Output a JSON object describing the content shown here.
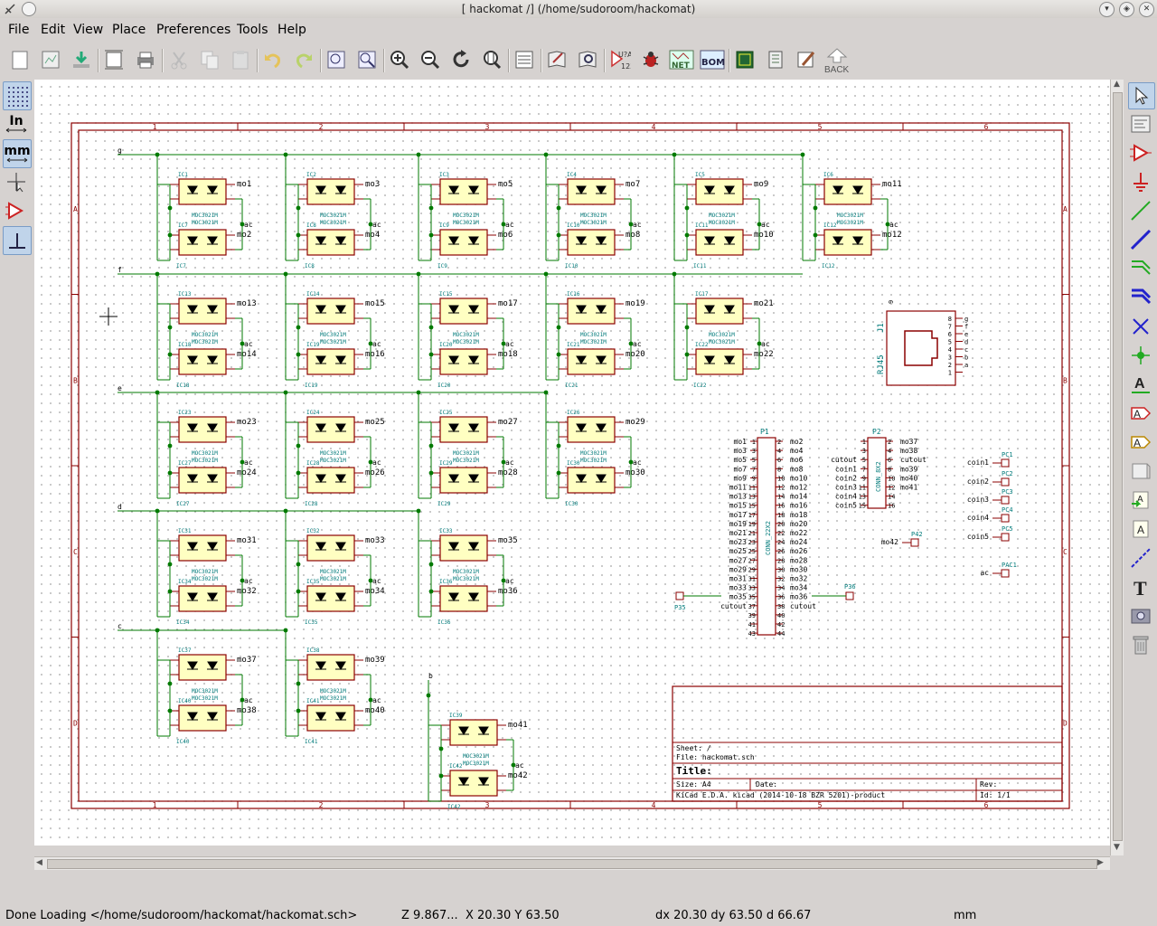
{
  "window": {
    "title": "[ hackomat /] (/home/sudoroom/hackomat)"
  },
  "menu": [
    "File",
    "Edit",
    "View",
    "Place",
    "Preferences",
    "Tools",
    "Help"
  ],
  "toolbar": {
    "back_label": "BACK",
    "net_label": "NET",
    "bom_label": "BOM",
    "annotate_label": "U?A 123"
  },
  "left_toolbar": {
    "inch_label": "In",
    "mm_label": "mm"
  },
  "status": {
    "message": "Done Loading </home/sudoroom/hackomat/hackomat.sch>",
    "zoom": "Z 9.867...",
    "xy": "X 20.30  Y 63.50",
    "delta": "dx 20.30  dy 63.50  d 66.67",
    "units": "mm"
  },
  "schematic": {
    "border_cols": [
      "1",
      "2",
      "3",
      "4",
      "5",
      "6"
    ],
    "border_rows": [
      "A",
      "B",
      "C",
      "D"
    ],
    "bus_labels": [
      "g",
      "f",
      "e",
      "d",
      "c",
      "b"
    ],
    "part_value": "MOC3021M",
    "pin_labels": [
      "a",
      "b",
      "c",
      "d",
      "e",
      "f",
      "g",
      "ac"
    ],
    "rows": [
      {
        "pairs": [
          {
            "ic_top": "IC1",
            "ic_bot": "IC7",
            "out_top": "mo1",
            "out_bot": "mo2"
          },
          {
            "ic_top": "IC2",
            "ic_bot": "IC8",
            "out_top": "mo3",
            "out_bot": "mo4"
          },
          {
            "ic_top": "IC3",
            "ic_bot": "IC9",
            "out_top": "mo5",
            "out_bot": "mo6"
          },
          {
            "ic_top": "IC4",
            "ic_bot": "IC10",
            "out_top": "mo7",
            "out_bot": "mo8"
          },
          {
            "ic_top": "IC5",
            "ic_bot": "IC11",
            "out_top": "mo9",
            "out_bot": "mo10"
          },
          {
            "ic_top": "IC6",
            "ic_bot": "IC12",
            "out_top": "mo11",
            "out_bot": "mo12"
          }
        ]
      },
      {
        "pairs": [
          {
            "ic_top": "IC13",
            "ic_bot": "IC18",
            "out_top": "mo13",
            "out_bot": "mo14"
          },
          {
            "ic_top": "IC14",
            "ic_bot": "IC19",
            "out_top": "mo15",
            "out_bot": "mo16"
          },
          {
            "ic_top": "IC15",
            "ic_bot": "IC20",
            "out_top": "mo17",
            "out_bot": "mo18"
          },
          {
            "ic_top": "IC16",
            "ic_bot": "IC21",
            "out_top": "mo19",
            "out_bot": "mo20"
          },
          {
            "ic_top": "IC17",
            "ic_bot": "IC22",
            "out_top": "mo21",
            "out_bot": "mo22"
          }
        ]
      },
      {
        "pairs": [
          {
            "ic_top": "IC23",
            "ic_bot": "IC27",
            "out_top": "mo23",
            "out_bot": "mo24"
          },
          {
            "ic_top": "IC24",
            "ic_bot": "IC28",
            "out_top": "mo25",
            "out_bot": "mo26"
          },
          {
            "ic_top": "IC25",
            "ic_bot": "IC29",
            "out_top": "mo27",
            "out_bot": "mo28"
          },
          {
            "ic_top": "IC26",
            "ic_bot": "IC30",
            "out_top": "mo29",
            "out_bot": "mo30"
          }
        ]
      },
      {
        "pairs": [
          {
            "ic_top": "IC31",
            "ic_bot": "IC34",
            "out_top": "mo31",
            "out_bot": "mo32"
          },
          {
            "ic_top": "IC32",
            "ic_bot": "IC35",
            "out_top": "mo33",
            "out_bot": "mo34"
          },
          {
            "ic_top": "IC33",
            "ic_bot": "IC36",
            "out_top": "mo35",
            "out_bot": "mo36"
          }
        ]
      },
      {
        "pairs": [
          {
            "ic_top": "IC37",
            "ic_bot": "IC40",
            "out_top": "mo37",
            "out_bot": "mo38"
          },
          {
            "ic_top": "IC38",
            "ic_bot": "IC41",
            "out_top": "mo39",
            "out_bot": "mo40"
          }
        ]
      },
      {
        "pairs": [
          {
            "ic_top": "IC39",
            "ic_bot": "IC42",
            "out_top": "mo41",
            "out_bot": "mo42"
          }
        ]
      }
    ],
    "rj45": {
      "ref": "J1",
      "value": "RJ45",
      "pins": [
        "8",
        "7",
        "6",
        "5",
        "4",
        "3",
        "2",
        "1"
      ],
      "nets": [
        "g",
        "f",
        "e",
        "d",
        "c",
        "b",
        "a"
      ],
      "shield": "9"
    },
    "p1": {
      "ref": "P1",
      "value": "CONN_22X2",
      "left": [
        "mo1",
        "mo3",
        "mo5",
        "mo7",
        "mo9",
        "mo11",
        "mo13",
        "mo15",
        "mo17",
        "mo19",
        "mo21",
        "mo23",
        "mo25",
        "mo27",
        "mo29",
        "mo31",
        "mo33",
        "mo35",
        "cutout",
        "",
        "",
        ""
      ],
      "right": [
        "mo2",
        "mo4",
        "mo6",
        "mo8",
        "mo10",
        "mo12",
        "mo14",
        "mo16",
        "mo18",
        "mo20",
        "mo22",
        "mo24",
        "mo26",
        "mo28",
        "mo30",
        "mo32",
        "mo34",
        "mo36",
        "cutout",
        "",
        "",
        ""
      ]
    },
    "p2": {
      "ref": "P2",
      "value": "CONN_8X2",
      "left": [
        "",
        "",
        "cutout",
        "coin1",
        "coin2",
        "coin3",
        "coin4",
        "coin5"
      ],
      "right": [
        "mo37",
        "mo38",
        "cutout",
        "mo39",
        "mo40",
        "mo41",
        "",
        ""
      ]
    },
    "singles": [
      {
        "net": "coin1",
        "ref": "PC1"
      },
      {
        "net": "coin2",
        "ref": "PC2"
      },
      {
        "net": "coin3",
        "ref": "PC3"
      },
      {
        "net": "coin4",
        "ref": "PC4"
      },
      {
        "net": "coin5",
        "ref": "PC5"
      },
      {
        "net": "mo42",
        "ref": "P42"
      },
      {
        "net": "ac",
        "ref": "PAC1"
      }
    ],
    "p35": "P35",
    "p36": "P36",
    "title_block": {
      "sheet": "Sheet: /",
      "file": "File: hackomat.sch",
      "title": "Title:",
      "size": "Size: A4",
      "date": "Date:",
      "rev": "Rev:",
      "app": "KiCad E.D.A.  kicad (2014-10-18 BZR 5201)-product",
      "id": "Id: 1/1"
    }
  }
}
